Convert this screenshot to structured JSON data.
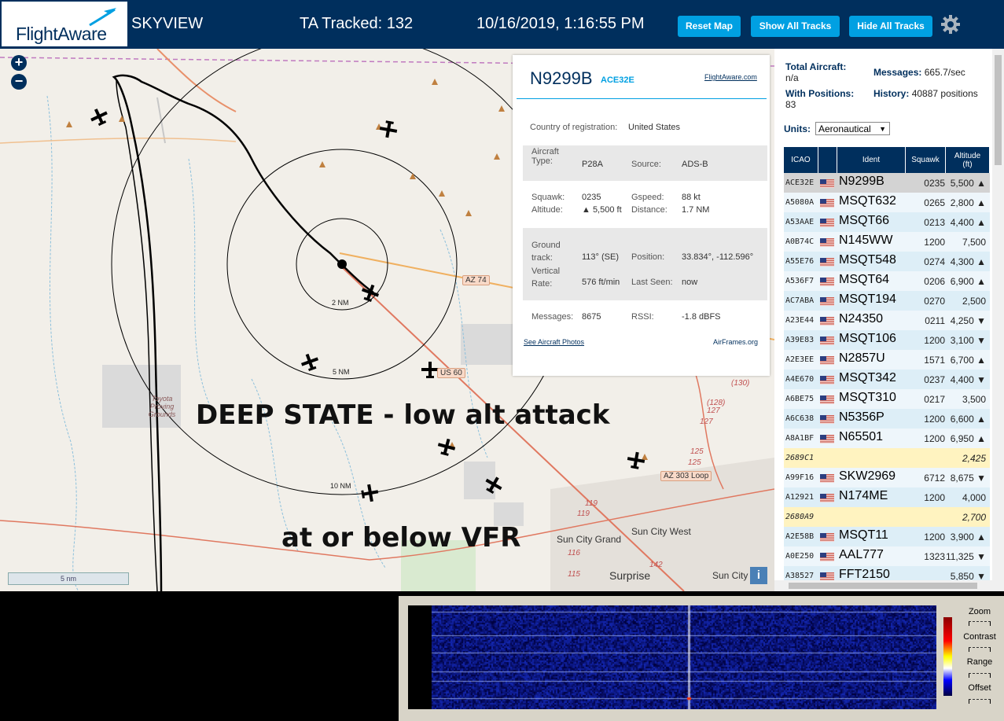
{
  "header": {
    "brand": "FlightAware",
    "app_title": "SKYVIEW",
    "tracked_label": "TA Tracked: 132",
    "datetime": "10/16/2019, 1:16:55 PM",
    "buttons": {
      "reset_map": "Reset Map",
      "show_all": "Show All Tracks",
      "hide_all": "Hide All Tracks"
    },
    "settings_icon": "gear-icon"
  },
  "map": {
    "zoom_in": "+",
    "zoom_out": "−",
    "scale_label": "5 nm",
    "ring_labels": [
      "2 NM",
      "5 NM",
      "10 NM"
    ],
    "road_labels": [
      "AZ 74",
      "US 60",
      "AZ 303 Loop"
    ],
    "route_numbers": [
      "(128)",
      "127",
      "127",
      "125",
      "125",
      "(130)",
      "119",
      "119",
      "116",
      "115",
      "142"
    ],
    "places": [
      "Toyota Proving Grounds",
      "Sun City Grand",
      "Sun City West",
      "Surprise",
      "Sun City"
    ],
    "overlay_line1": "DEEP STATE - low alt attack",
    "overlay_line2": "at or below VFR",
    "info_button": "i"
  },
  "popup": {
    "registration": "N9299B",
    "hex": "ACE32E",
    "fa_link": "FlightAware.com",
    "country_label": "Country of registration:",
    "country_value": "United States",
    "aircraft_type_label": "Aircraft Type:",
    "aircraft_type_value": "P28A",
    "source_label": "Source:",
    "source_value": "ADS-B",
    "squawk_label": "Squawk:",
    "squawk_value": "0235",
    "gspeed_label": "Gspeed:",
    "gspeed_value": "88 kt",
    "altitude_label": "Altitude:",
    "altitude_value": "▲ 5,500 ft",
    "distance_label": "Distance:",
    "distance_value": "1.7 NM",
    "ground_track_label": "Ground track:",
    "ground_track_value": "113° (SE)",
    "position_label": "Position:",
    "position_value": "33.834°, -112.596°",
    "vertical_rate_label": "Vertical Rate:",
    "vertical_rate_value": "576 ft/min",
    "last_seen_label": "Last Seen:",
    "last_seen_value": "now",
    "messages_label": "Messages:",
    "messages_value": "8675",
    "rssi_label": "RSSI:",
    "rssi_value": "-1.8 dBFS",
    "photos_link": "See Aircraft Photos",
    "airframes_link": "AirFrames.org"
  },
  "stats": {
    "total_label": "Total Aircraft:",
    "total_value": "n/a",
    "messages_label": "Messages:",
    "messages_value": "665.7/sec",
    "positions_label": "With Positions:",
    "positions_value": "83",
    "history_label": "History:",
    "history_value": "40887 positions",
    "units_label": "Units:",
    "units_value": "Aeronautical"
  },
  "table": {
    "headers": [
      "ICAO",
      "",
      "Ident",
      "Squawk",
      "Altitude (ft)"
    ],
    "rows": [
      {
        "icao": "ACE32E",
        "ident": "N9299B",
        "squawk": "0235",
        "alt": "5,500 ▲",
        "flag": true
      },
      {
        "icao": "A5080A",
        "ident": "MSQT632",
        "squawk": "0265",
        "alt": "2,800 ▲",
        "flag": true
      },
      {
        "icao": "A53AAE",
        "ident": "MSQT66",
        "squawk": "0213",
        "alt": "4,400 ▲",
        "flag": true
      },
      {
        "icao": "A0B74C",
        "ident": "N145WW",
        "squawk": "1200",
        "alt": "7,500",
        "flag": true
      },
      {
        "icao": "A55E76",
        "ident": "MSQT548",
        "squawk": "0274",
        "alt": "4,300 ▲",
        "flag": true
      },
      {
        "icao": "A536F7",
        "ident": "MSQT64",
        "squawk": "0206",
        "alt": "6,900 ▲",
        "flag": true
      },
      {
        "icao": "AC7ABA",
        "ident": "MSQT194",
        "squawk": "0270",
        "alt": "2,500",
        "flag": true
      },
      {
        "icao": "A23E44",
        "ident": "N24350",
        "squawk": "0211",
        "alt": "4,250 ▼",
        "flag": true
      },
      {
        "icao": "A39E83",
        "ident": "MSQT106",
        "squawk": "1200",
        "alt": "3,100 ▼",
        "flag": true
      },
      {
        "icao": "A2E3EE",
        "ident": "N2857U",
        "squawk": "1571",
        "alt": "6,700 ▲",
        "flag": true
      },
      {
        "icao": "A4E670",
        "ident": "MSQT342",
        "squawk": "0237",
        "alt": "4,400 ▼",
        "flag": true
      },
      {
        "icao": "A6BE75",
        "ident": "MSQT310",
        "squawk": "0217",
        "alt": "3,500",
        "flag": true
      },
      {
        "icao": "A6C638",
        "ident": "N5356P",
        "squawk": "1200",
        "alt": "6,600 ▲",
        "flag": true
      },
      {
        "icao": "A8A1BF",
        "ident": "N65501",
        "squawk": "1200",
        "alt": "6,950 ▲",
        "flag": true
      },
      {
        "icao": "2689C1",
        "ident": "",
        "squawk": "",
        "alt": "2,425",
        "flag": false
      },
      {
        "icao": "A99F16",
        "ident": "SKW2969",
        "squawk": "6712",
        "alt": "8,675 ▼",
        "flag": true
      },
      {
        "icao": "A12921",
        "ident": "N174ME",
        "squawk": "1200",
        "alt": "4,000",
        "flag": true
      },
      {
        "icao": "2680A9",
        "ident": "",
        "squawk": "",
        "alt": "2,700",
        "flag": false
      },
      {
        "icao": "A2E58B",
        "ident": "MSQT11",
        "squawk": "1200",
        "alt": "3,900 ▲",
        "flag": true
      },
      {
        "icao": "A0E250",
        "ident": "AAL777",
        "squawk": "1323",
        "alt": "11,325 ▼",
        "flag": true
      },
      {
        "icao": "A38527",
        "ident": "FFT2150",
        "squawk": "",
        "alt": "5,850 ▼",
        "flag": true
      }
    ]
  },
  "spectrum": {
    "controls": [
      "Zoom",
      "Contrast",
      "Range",
      "Offset"
    ]
  },
  "colors": {
    "header_bg": "#002f5d",
    "button_bg": "#00a0e2",
    "row_odd": "#ddeef7",
    "row_nopos": "#fff3c0"
  }
}
